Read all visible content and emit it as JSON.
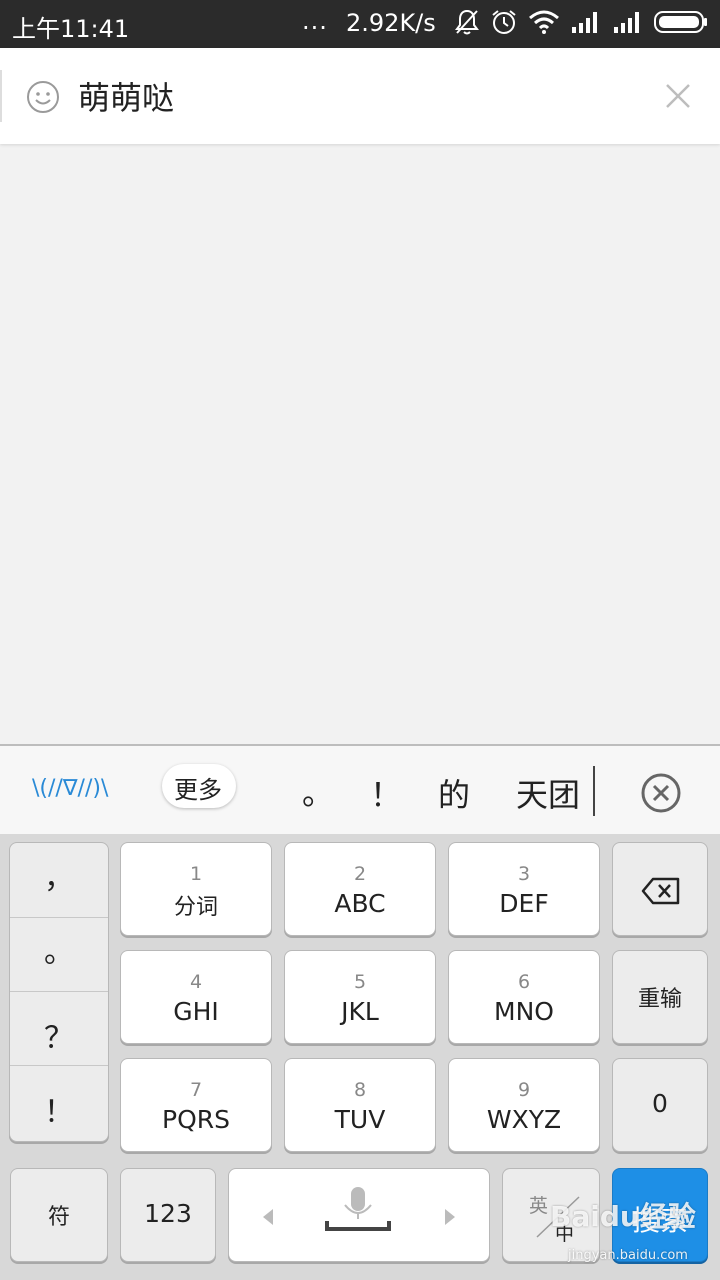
{
  "status_bar": {
    "time": "上午11:41",
    "dots": "...",
    "net_speed": "2.92K/s",
    "icons": [
      "mute-bell-icon",
      "alarm-icon",
      "wifi-icon",
      "signal-icon",
      "signal-icon-2",
      "battery-icon"
    ]
  },
  "search": {
    "value": "萌萌哒",
    "emoji_icon": "smiley-icon",
    "clear_icon": "close-icon"
  },
  "candidates": {
    "kaomoji": "\\(//∇//)\\",
    "more": "更多",
    "items": [
      "。",
      "！",
      "的",
      "天团"
    ],
    "close_icon": "circle-close-icon"
  },
  "keyboard": {
    "punctuation": [
      "，",
      "。",
      "？",
      "！"
    ],
    "keys": [
      {
        "num": "1",
        "label": "分词"
      },
      {
        "num": "2",
        "label": "ABC"
      },
      {
        "num": "3",
        "label": "DEF"
      },
      {
        "num": "4",
        "label": "GHI"
      },
      {
        "num": "5",
        "label": "JKL"
      },
      {
        "num": "6",
        "label": "MNO"
      },
      {
        "num": "7",
        "label": "PQRS"
      },
      {
        "num": "8",
        "label": "TUV"
      },
      {
        "num": "9",
        "label": "WXYZ"
      }
    ],
    "right_column": {
      "backspace_icon": "backspace-icon",
      "retype": "重输",
      "zero": "0"
    },
    "bottom": {
      "symbols": "符",
      "numbers": "123",
      "mic_icon": "microphone-icon",
      "lang_top": "英",
      "lang_bottom": "中",
      "search": "搜索"
    }
  },
  "watermark": {
    "text": "Baidu经验",
    "url": "jingyan.baidu.com"
  },
  "colors": {
    "accent": "#1e8fe6",
    "kaomoji": "#2a8ad6"
  }
}
